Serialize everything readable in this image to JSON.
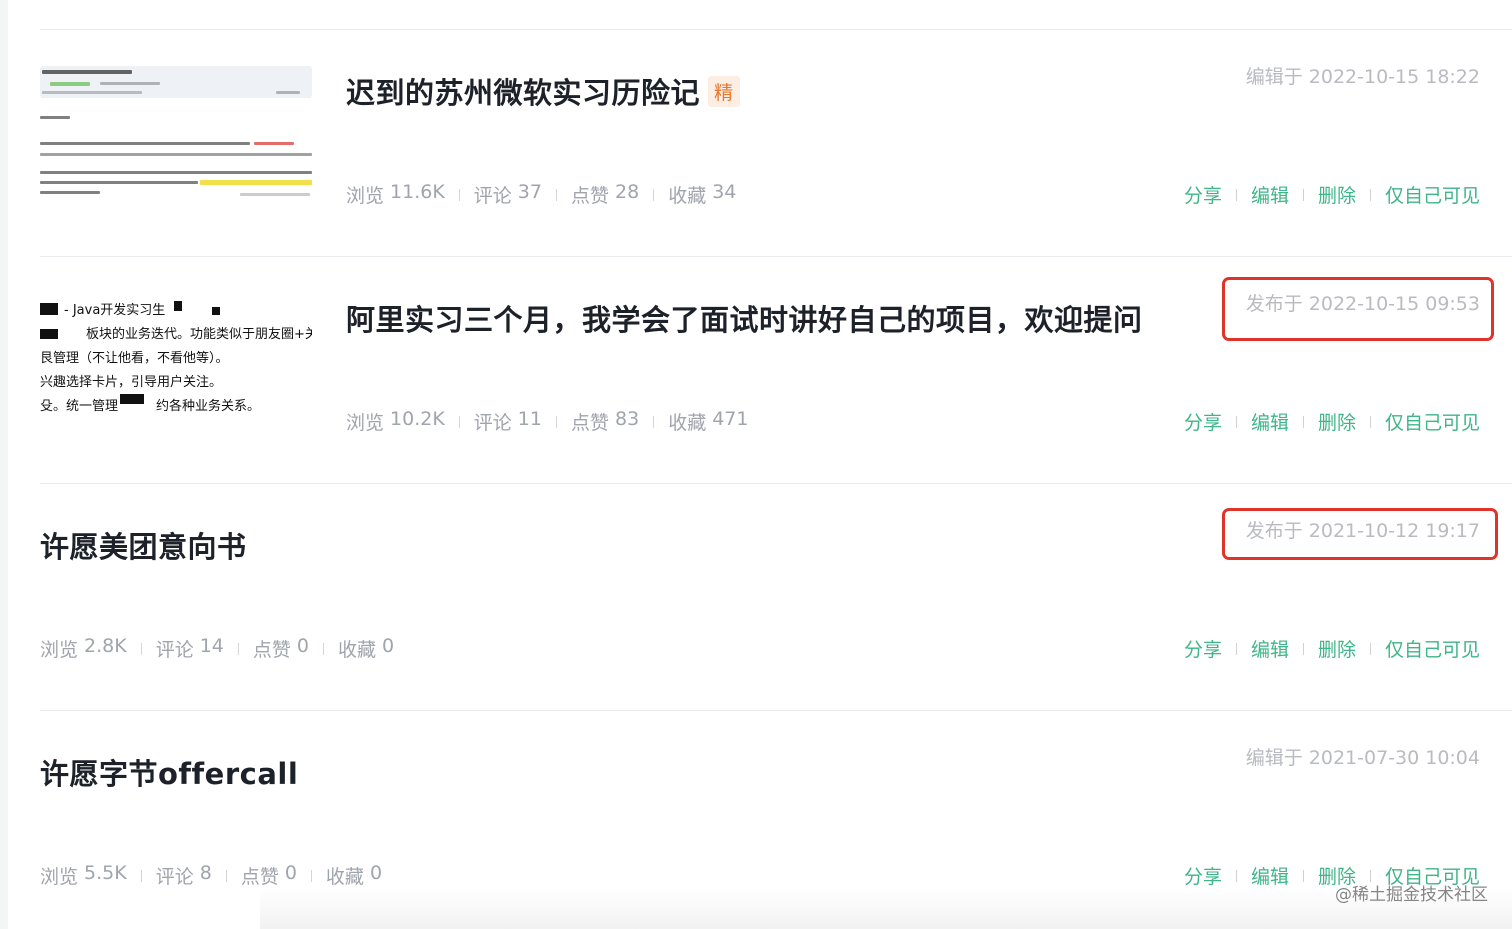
{
  "articles": [
    {
      "title": "迟到的苏州微软实习历险记",
      "badge": "精",
      "date": "编辑于 2022-10-15 18:22",
      "highlighted": false,
      "has_thumb": true,
      "stats": {
        "views_label": "浏览",
        "views": "11.6K",
        "comments_label": "评论",
        "comments": "37",
        "likes_label": "点赞",
        "likes": "28",
        "favorites_label": "收藏",
        "favorites": "34"
      }
    },
    {
      "title": "阿里实习三个月，我学会了面试时讲好自己的项目，欢迎提问",
      "badge": "",
      "date": "发布于 2022-10-15 09:53",
      "highlighted": true,
      "has_thumb": true,
      "thumb_lines": [
        "- Java开发实习生",
        "板块的业务迭代。功能类似于朋友圈+关",
        "艮管理（不让他看，不看他等）。",
        "兴趣选择卡片，引导用户关注。",
        "殳。统一管理",
        "约各种业务关系。"
      ],
      "stats": {
        "views_label": "浏览",
        "views": "10.2K",
        "comments_label": "评论",
        "comments": "11",
        "likes_label": "点赞",
        "likes": "83",
        "favorites_label": "收藏",
        "favorites": "471"
      }
    },
    {
      "title": "许愿美团意向书",
      "badge": "",
      "date": "发布于 2021-10-12 19:17",
      "highlighted": true,
      "has_thumb": false,
      "stats": {
        "views_label": "浏览",
        "views": "2.8K",
        "comments_label": "评论",
        "comments": "14",
        "likes_label": "点赞",
        "likes": "0",
        "favorites_label": "收藏",
        "favorites": "0"
      }
    },
    {
      "title": "许愿字节offercall",
      "badge": "",
      "date": "编辑于 2021-07-30 10:04",
      "highlighted": false,
      "has_thumb": false,
      "stats": {
        "views_label": "浏览",
        "views": "5.5K",
        "comments_label": "评论",
        "comments": "8",
        "likes_label": "点赞",
        "likes": "0",
        "favorites_label": "收藏",
        "favorites": "0"
      }
    }
  ],
  "actions": {
    "share": "分享",
    "edit": "编辑",
    "delete": "删除",
    "visibility": "仅自己可见"
  },
  "watermark": "@稀土掘金技术社区",
  "colors": {
    "action_green": "#3fb588",
    "highlight_box": "#e0332a",
    "badge_orange": "#e8772e",
    "meta_gray": "#a0a4ad"
  }
}
